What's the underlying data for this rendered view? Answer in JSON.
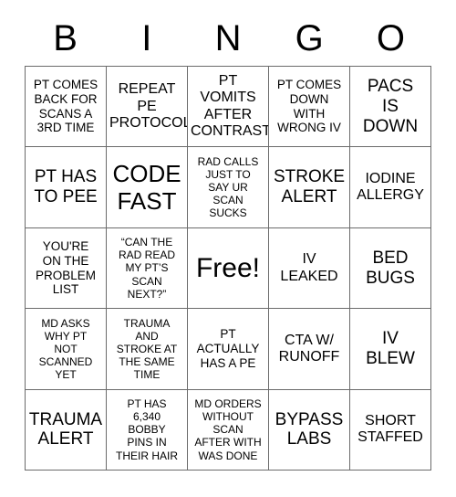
{
  "card": {
    "header_letters": [
      "B",
      "I",
      "N",
      "G",
      "O"
    ],
    "rows": [
      [
        {
          "text": "PT COMES\nBACK FOR\nSCANS A\n3RD TIME",
          "size": "sm"
        },
        {
          "text": "REPEAT PE\nPROTOCOL",
          "size": "md"
        },
        {
          "text": "PT VOMITS\nAFTER\nCONTRAST",
          "size": "md"
        },
        {
          "text": "PT COMES\nDOWN\nWITH\nWRONG IV",
          "size": "sm"
        },
        {
          "text": "PACS\nIS\nDOWN",
          "size": "lg"
        }
      ],
      [
        {
          "text": "PT HAS\nTO PEE",
          "size": "lg"
        },
        {
          "text": "CODE\nFAST",
          "size": "xl"
        },
        {
          "text": "RAD CALLS\nJUST TO\nSAY UR\nSCAN\nSUCKS",
          "size": "xs"
        },
        {
          "text": "STROKE\nALERT",
          "size": "lg"
        },
        {
          "text": "IODINE\nALLERGY",
          "size": "md"
        }
      ],
      [
        {
          "text": "YOU'RE\nON THE\nPROBLEM\nLIST",
          "size": "sm"
        },
        {
          "text": "“CAN THE\nRAD READ\nMY PT’S\nSCAN\nNEXT?”",
          "size": "xs"
        },
        {
          "text": "Free!",
          "size": "free"
        },
        {
          "text": "IV\nLEAKED",
          "size": "md"
        },
        {
          "text": "BED\nBUGS",
          "size": "lg"
        }
      ],
      [
        {
          "text": "MD ASKS\nWHY PT\nNOT\nSCANNED\nYET",
          "size": "xs"
        },
        {
          "text": "TRAUMA\nAND\nSTROKE AT\nTHE SAME\nTIME",
          "size": "xs"
        },
        {
          "text": "PT\nACTUALLY\nHAS A PE",
          "size": "sm"
        },
        {
          "text": "CTA W/\nRUNOFF",
          "size": "md"
        },
        {
          "text": "IV\nBLEW",
          "size": "lg"
        }
      ],
      [
        {
          "text": "TRAUMA\nALERT",
          "size": "lg"
        },
        {
          "text": "PT HAS\n6,340\nBOBBY\nPINS IN\nTHEIR HAIR",
          "size": "xs"
        },
        {
          "text": "MD ORDERS\nWITHOUT\nSCAN\nAFTER WITH\nWAS DONE",
          "size": "xs"
        },
        {
          "text": "BYPASS\nLABS",
          "size": "lg"
        },
        {
          "text": "SHORT\nSTAFFED",
          "size": "md"
        }
      ]
    ]
  },
  "colors": {
    "background": "#ffffff",
    "text": "#000000",
    "grid_line": "#6b6b6b"
  }
}
